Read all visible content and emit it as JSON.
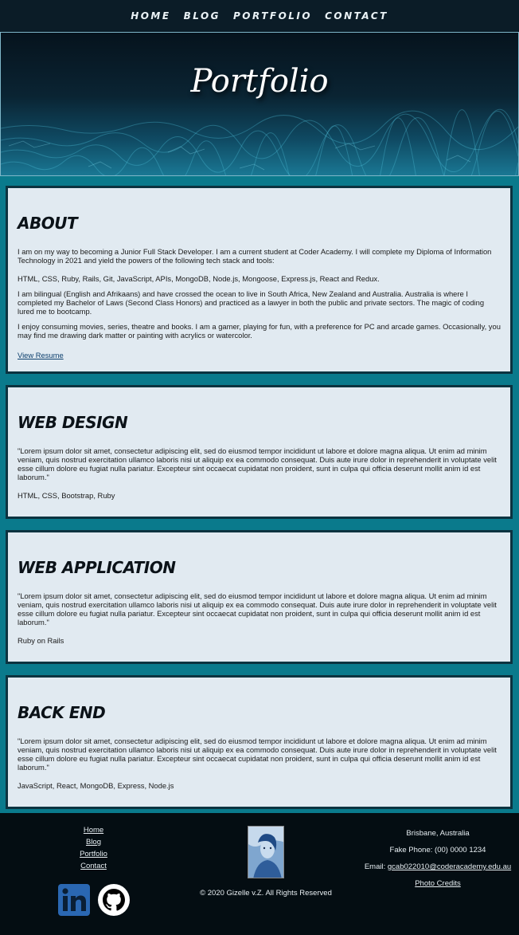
{
  "nav": {
    "items": [
      "HOME",
      "BLOG",
      "PORTFOLIO",
      "CONTACT"
    ]
  },
  "hero": {
    "title": "Portfolio"
  },
  "about": {
    "heading": "ABOUT",
    "p1": "I am on my way to becoming a Junior Full Stack Developer. I am a current student at Coder Academy. I will complete my Diploma of Information Technology in 2021 and yield the powers of the following tech stack and tools:",
    "p2": "HTML, CSS, Ruby, Rails, Git, JavaScript, APIs, MongoDB, Node.js, Mongoose, Express.js, React and Redux.",
    "p3": "I am bilingual (English and Afrikaans) and have crossed the ocean to live in South Africa, New Zealand and Australia. Australia is where I completed my Bachelor of Laws (Second Class Honors) and practiced as a lawyer in both the public and private sectors. The magic of coding lured me to bootcamp.",
    "p4": "I enjoy consuming movies, series, theatre and books. I am a gamer, playing for fun, with a preference for PC and arcade games. Occasionally, you may find me drawing dark matter or painting with acrylics or watercolor.",
    "link": "View Resume"
  },
  "web_design": {
    "heading": "WEB DESIGN",
    "text": "\"Lorem ipsum dolor sit amet, consectetur adipiscing elit, sed do eiusmod tempor incididunt ut labore et dolore magna aliqua. Ut enim ad minim veniam, quis nostrud exercitation ullamco laboris nisi ut aliquip ex ea commodo consequat. Duis aute irure dolor in reprehenderit in voluptate velit esse cillum dolore eu fugiat nulla pariatur. Excepteur sint occaecat cupidatat non proident, sunt in culpa qui officia deserunt mollit anim id est laborum.\"",
    "tech": "HTML, CSS, Bootstrap, Ruby"
  },
  "web_application": {
    "heading": "WEB APPLICATION",
    "text": "\"Lorem ipsum dolor sit amet, consectetur adipiscing elit, sed do eiusmod tempor incididunt ut labore et dolore magna aliqua. Ut enim ad minim veniam, quis nostrud exercitation ullamco laboris nisi ut aliquip ex ea commodo consequat. Duis aute irure dolor in reprehenderit in voluptate velit esse cillum dolore eu fugiat nulla pariatur. Excepteur sint occaecat cupidatat non proident, sunt in culpa qui officia deserunt mollit anim id est laborum.\"",
    "tech": "Ruby on Rails"
  },
  "back_end": {
    "heading": "BACK END",
    "text": "\"Lorem ipsum dolor sit amet, consectetur adipiscing elit, sed do eiusmod tempor incididunt ut labore et dolore magna aliqua. Ut enim ad minim veniam, quis nostrud exercitation ullamco laboris nisi ut aliquip ex ea commodo consequat. Duis aute irure dolor in reprehenderit in voluptate velit esse cillum dolore eu fugiat nulla pariatur. Excepteur sint occaecat cupidatat non proident, sunt in culpa qui officia deserunt mollit anim id est laborum.\"",
    "tech": "JavaScript, React, MongoDB, Express, Node.js"
  },
  "footer": {
    "links": [
      "Home",
      "Blog",
      "Portfolio",
      "Contact"
    ],
    "copyright": "© 2020 Gizelle v.Z. All Rights Reserved",
    "location": "Brisbane, Australia",
    "phone": "Fake Phone: (00) 0000 1234",
    "email_label": "Email: ",
    "email": "gcab022010@coderacademy.edu.au",
    "photo_credits": "Photo Credits",
    "social_icons": [
      "linkedin-icon",
      "github-icon"
    ]
  },
  "colors": {
    "page_bg": "#0a7a8c",
    "nav_bg": "#0b1c27",
    "card_bg": "#e1eaf1",
    "card_border": "#0c3340",
    "footer_bg": "#040d12"
  }
}
